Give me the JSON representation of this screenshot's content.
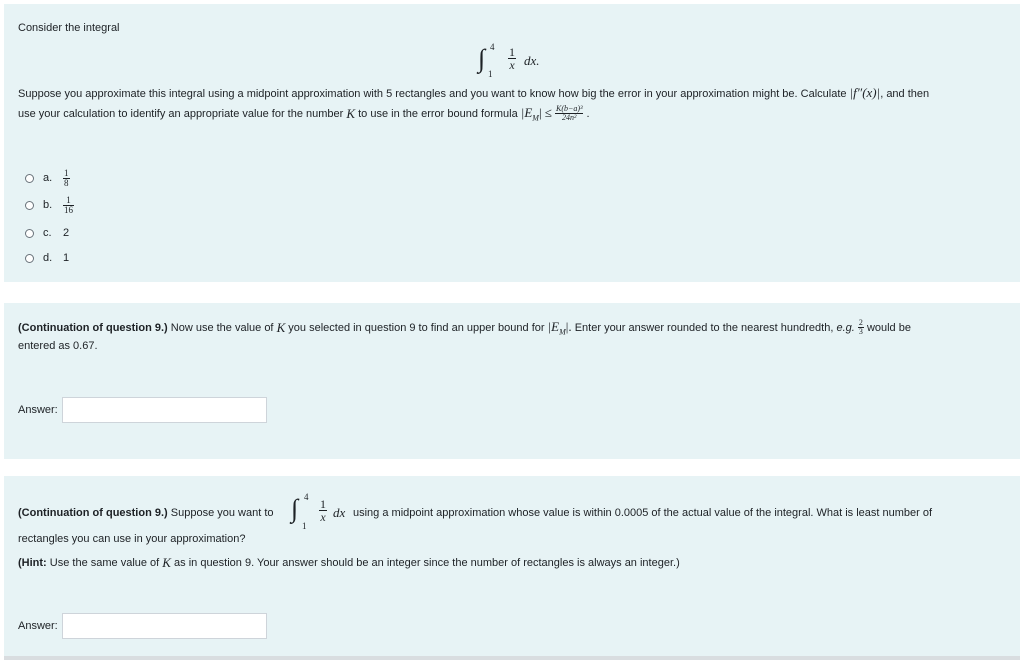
{
  "q1": {
    "intro": "Consider the integral",
    "integral": {
      "lower": "1",
      "upper": "4",
      "num": "1",
      "den": "x",
      "dx": "dx."
    },
    "text_a": "Suppose you approximate this integral using a midpoint approximation with 5 rectangles and you want to know how big the error in your approximation might be. Calculate",
    "f_abs": "|f″(x)|",
    "text_b": ", and then",
    "text_c": "use your calculation to identify an appropriate value for the number",
    "k": "K",
    "text_d": "to use in the error bound formula",
    "em": "|E",
    "em_sub": "M",
    "em_close": "| ≤",
    "bound_num": "K(b−a)³",
    "bound_den": "24n²",
    "bound_end": ".",
    "options": [
      {
        "letter": "a.",
        "num": "1",
        "den": "8"
      },
      {
        "letter": "b.",
        "num": "1",
        "den": "16"
      },
      {
        "letter": "c.",
        "value": "2"
      },
      {
        "letter": "d.",
        "value": "1"
      }
    ]
  },
  "q2": {
    "bold_lead": "(Continuation of question 9.)",
    "text_a": "Now use the value of",
    "k": "K",
    "text_b": "you selected in question 9 to find an upper bound for",
    "em": "|E",
    "em_sub": "M",
    "em_close": "|.",
    "text_c": "Enter your answer rounded to the nearest hundredth,",
    "eg": "e.g.",
    "eg_num": "2",
    "eg_den": "3",
    "text_d": "would be",
    "text_e": "entered as 0.67.",
    "answer_label": "Answer:",
    "answer_value": ""
  },
  "q3": {
    "bold_lead": "(Continuation of question 9.)",
    "text_a": "Suppose you want to",
    "integral": {
      "lower": "1",
      "upper": "4",
      "num": "1",
      "den": "x",
      "dx": "dx"
    },
    "text_b": "using a midpoint approximation whose value is within 0.0005 of the actual value of the integral. What is least number of",
    "text_c": "rectangles you can use in your approximation?",
    "hint_bold": "(Hint:",
    "hint_a": "Use the same value of",
    "k": "K",
    "hint_b": "as in question 9. Your answer should be an integer since the number of rectangles is always an integer.)",
    "answer_label": "Answer:",
    "answer_value": ""
  }
}
